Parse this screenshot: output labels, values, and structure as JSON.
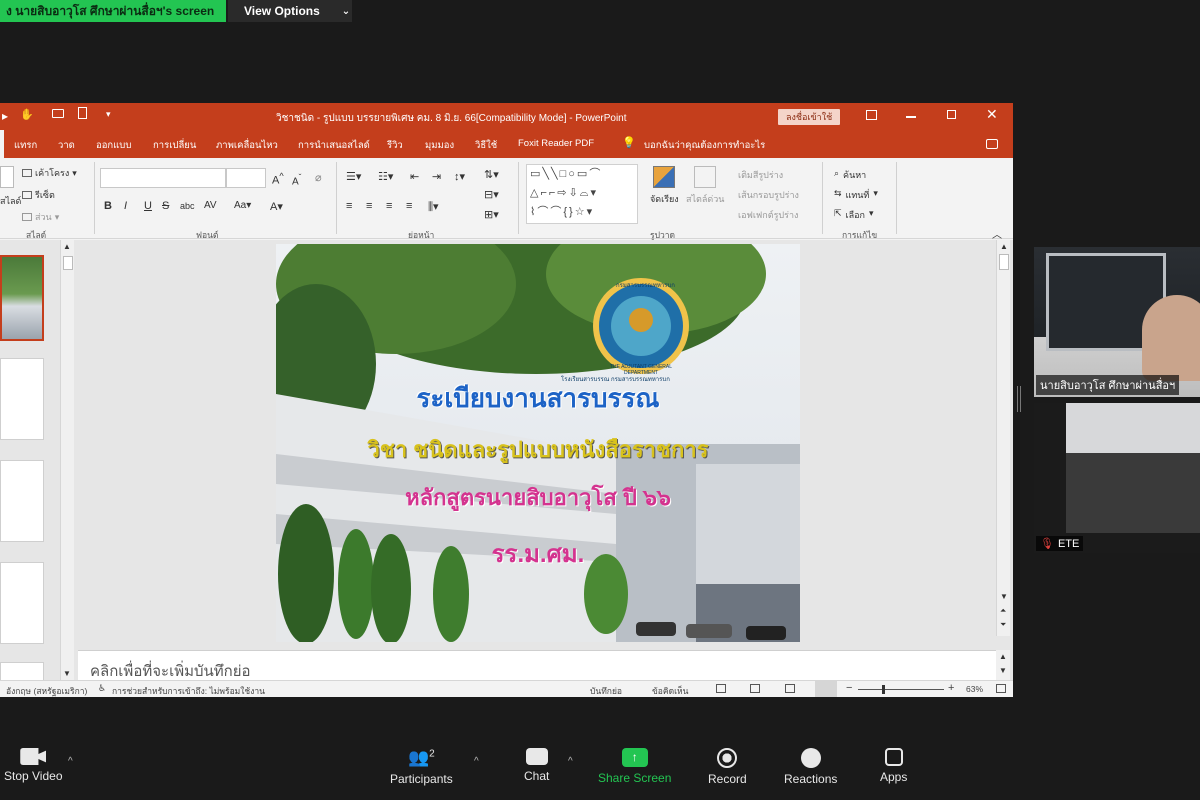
{
  "meeting": {
    "share_banner": "ง นายสิบอาวุโส ศึกษาผ่านสื่อฯ's screen",
    "view_options": "View Options"
  },
  "ppt": {
    "window_title": "วิชาชนิด - รูปแบบ บรรยายพิเศษ คม. 8 มิ.ย. 66[Compatibility Mode] - PowerPoint",
    "signin_label": "ลงชื่อเข้าใช้",
    "tabs": [
      "แทรก",
      "วาด",
      "ออกแบบ",
      "การเปลี่ยน",
      "ภาพเคลื่อนไหว",
      "การนำเสนอสไลด์",
      "รีวิว",
      "มุมมอง",
      "วิธีใช้",
      "Foxit Reader PDF",
      "บอกฉันว่าคุณต้องการทำอะไร"
    ],
    "ribbon": {
      "layout_label": "เค้าโครง",
      "reset_label": "รีเซ็ต",
      "section_label": "ส่วน",
      "slide_label": "สไลด์",
      "slides_group": "สไลด์",
      "font_group": "ฟอนต์",
      "paragraph_group": "ย่อหน้า",
      "drawing_group": "รูปวาด",
      "editing_group": "การแก้ไข",
      "arrange_label": "จัดเรียง",
      "quick_styles_label": "สไตล์ด่วน",
      "shape_fill": "เติมสีรูปร่าง",
      "shape_outline": "เส้นกรอบรูปร่าง",
      "shape_effects": "เอฟเฟกต์รูปร่าง",
      "find_label": "ค้นหา",
      "replace_label": "แทนที่",
      "select_label": "เลือก"
    },
    "slide": {
      "title": "ระเบียบงานสารบรรณ",
      "subtitle": "วิชา ชนิดและรูปแบบหนังสือราชการ",
      "course": "หลักสูตรนายสิบอาวุโส ปี ๖๖",
      "school": "รร.ม.ศม.",
      "logo_ring_text": "THE ADJUTANT GENERAL DEPARTMENT",
      "logo_top_text": "กรมสารบรรณทหารบก",
      "logo_side_text": "โรงเรียนสารบรรณ กรมสารบรรณทหารบก"
    },
    "notes_placeholder": "คลิกเพื่อที่จะเพิ่มบันทึกย่อ",
    "status": {
      "language": "อังกฤษ (สหรัฐอเมริกา)",
      "accessibility": "การช่วยสำหรับการเข้าถึง: ไม่พร้อมใช้งาน",
      "notes": "บันทึกย่อ",
      "comments": "ข้อคิดเห็น",
      "zoom": "63%"
    }
  },
  "participants": [
    {
      "name": "นายสิบอาวุโส ศึกษาผ่านสื่อฯ"
    },
    {
      "name": "ETE"
    }
  ],
  "toolbar": {
    "stop_video": "Stop Video",
    "participants": "Participants",
    "participants_count": "2",
    "chat": "Chat",
    "share_screen": "Share Screen",
    "record": "Record",
    "reactions": "Reactions",
    "apps": "Apps"
  },
  "colors": {
    "ppt_accent": "#c43e1c",
    "share_green": "#23c552",
    "slide_title": "#1d63c6",
    "slide_subtitle": "#d8c21c",
    "slide_course": "#d4338f"
  }
}
